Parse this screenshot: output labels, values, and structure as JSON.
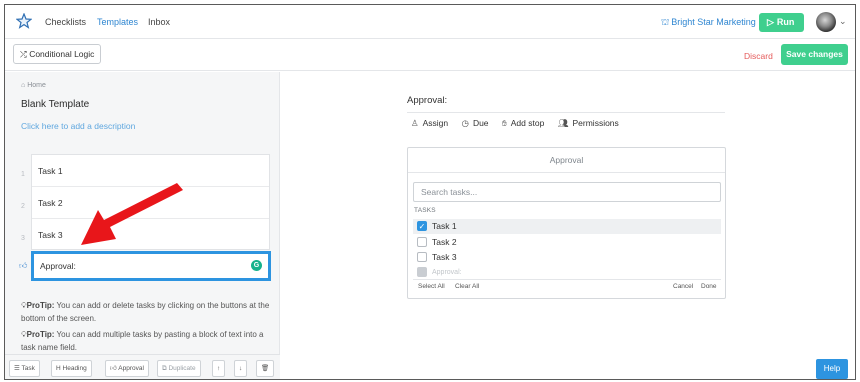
{
  "nav": {
    "links": [
      "Checklists",
      "Templates",
      "Inbox"
    ],
    "org_name": "Bright Star Marketing",
    "run_label": "Run"
  },
  "toolbar": {
    "conditional_logic_label": "Conditional Logic",
    "discard_label": "Discard",
    "save_label": "Save changes"
  },
  "left": {
    "breadcrumb": "Home",
    "title": "Blank Template",
    "description_placeholder": "Click here to add a description",
    "tasks": [
      {
        "num": "1",
        "label": "Task 1"
      },
      {
        "num": "2",
        "label": "Task 2"
      },
      {
        "num": "3",
        "label": "Task 3"
      }
    ],
    "approval_value": "Approval:",
    "tips": [
      {
        "label": "ProTip:",
        "text": " You can add or delete tasks by clicking on the buttons at the bottom of the screen."
      },
      {
        "label": "ProTip:",
        "text": " You can add multiple tasks by pasting a block of text into a task name field."
      }
    ],
    "bottom_buttons": [
      "Task",
      "Heading",
      "Approval",
      "Duplicate"
    ]
  },
  "right": {
    "title": "Approval:",
    "actions": [
      "Assign",
      "Due",
      "Add stop",
      "Permissions"
    ],
    "panel": {
      "heading": "Approval",
      "search_placeholder": "Search tasks...",
      "section_label": "TASKS",
      "items": [
        {
          "label": "Task 1",
          "checked": true
        },
        {
          "label": "Task 2",
          "checked": false
        },
        {
          "label": "Task 3",
          "checked": false
        },
        {
          "label": "Approval:",
          "disabled": true
        }
      ],
      "select_all": "Select All",
      "clear_all": "Clear All",
      "cancel": "Cancel",
      "done": "Done"
    }
  },
  "help_label": "Help",
  "colors": {
    "accent_blue": "#2d94e0",
    "green": "#3fcf8e",
    "discard_red": "#e55b5b",
    "annotation_arrow": "#e8161a"
  }
}
